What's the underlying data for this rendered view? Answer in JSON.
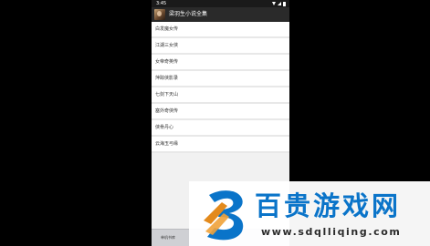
{
  "status_bar": {
    "time": "3:45"
  },
  "app": {
    "title": "梁羽生小说全集"
  },
  "list": {
    "items": [
      {
        "label": "白发魔女传"
      },
      {
        "label": "江湖三女侠"
      },
      {
        "label": "女帝奇英传"
      },
      {
        "label": "萍踪侠影录"
      },
      {
        "label": "七剑下天山"
      },
      {
        "label": "塞外奇侠传"
      },
      {
        "label": "侠骨丹心"
      },
      {
        "label": "云海玉弓缘"
      }
    ]
  },
  "bottom_bar": {
    "label": "单机书库"
  },
  "watermark": {
    "brand": "百贵游戏网",
    "url": "www.sdqlliqing.com",
    "color": "#0a74c9"
  }
}
